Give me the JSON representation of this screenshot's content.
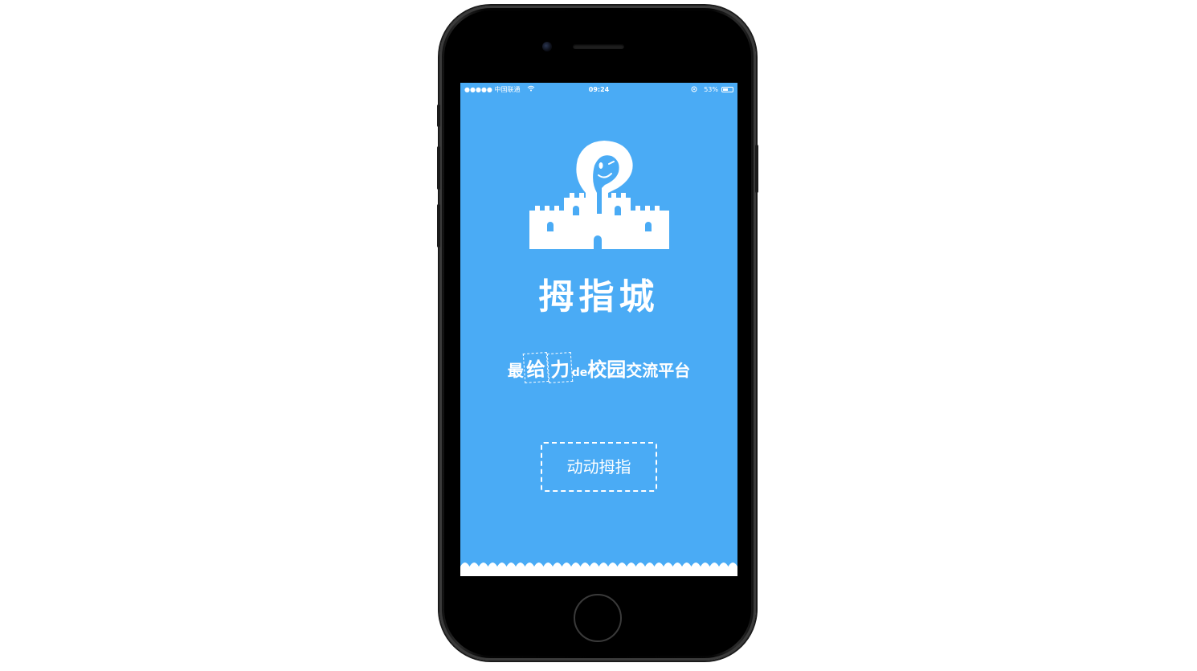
{
  "status_bar": {
    "carrier": "●●●●● 中国联通",
    "wifi_icon": "wifi-icon",
    "time": "09:24",
    "location_icon": "location-icon",
    "battery": "53%",
    "battery_level": 0.53
  },
  "splash": {
    "logo_icon": "castle-mascot-icon",
    "brand_name": "拇指城",
    "tagline_parts": [
      "最",
      "给",
      "力",
      "de",
      "校园",
      "交流平台"
    ],
    "button_label": "动动拇指"
  },
  "colors": {
    "screen_background": "#4aabf5",
    "text": "#ffffff",
    "phone_body": "#000000"
  }
}
